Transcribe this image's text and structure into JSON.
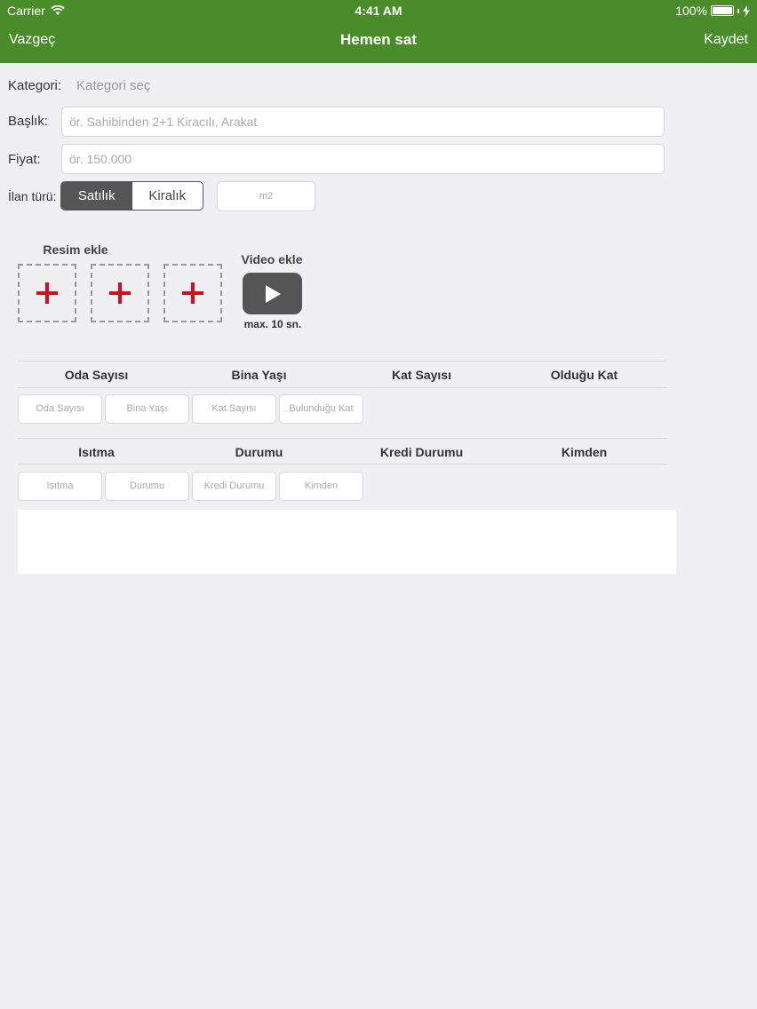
{
  "status_bar": {
    "carrier": "Carrier",
    "time": "4:41 AM",
    "battery": "100%",
    "battery_level": 1.0
  },
  "nav": {
    "cancel": "Vazgeç",
    "title": "Hemen sat",
    "save": "Kaydet"
  },
  "form": {
    "category_label": "Kategori:",
    "category_value": "Kategori seç",
    "title_label": "Başlık:",
    "title_placeholder": "ör. Sahibinden 2+1 Kiracılı, Arakat",
    "price_label": "Fiyat:",
    "price_placeholder": "ör. 150.000",
    "listing_type_label": "İlan türü:",
    "listing_types": [
      "Satılık",
      "Kiralık"
    ],
    "listing_type_selected": "Satılık",
    "area_placeholder": "m2"
  },
  "media": {
    "photo_title": "Resim ekle",
    "video_title": "Video ekle",
    "video_note": "max. 10 sn."
  },
  "details_1": {
    "headers": [
      "Oda Sayısı",
      "Bina Yaşı",
      "Kat Sayısı",
      "Olduğu Kat"
    ],
    "placeholders": [
      "Oda Sayısı",
      "Bina Yaşı",
      "Kat Sayısı",
      "Bulunduğu Kat"
    ]
  },
  "details_2": {
    "headers": [
      "Isıtma",
      "Durumu",
      "Kredi Durumu",
      "Kimden"
    ],
    "placeholders": [
      "Isıtma",
      "Durumu",
      "Kredi Durumu",
      "Kimden"
    ]
  },
  "icons": {
    "wifi": "wifi-icon",
    "battery": "battery-icon",
    "charging": "charging-icon",
    "add_photo": "plus-icon",
    "play": "play-icon"
  },
  "colors": {
    "nav_bg": "#4a8b2a",
    "plus_red": "#d0101e",
    "segment_active": "#555555"
  }
}
